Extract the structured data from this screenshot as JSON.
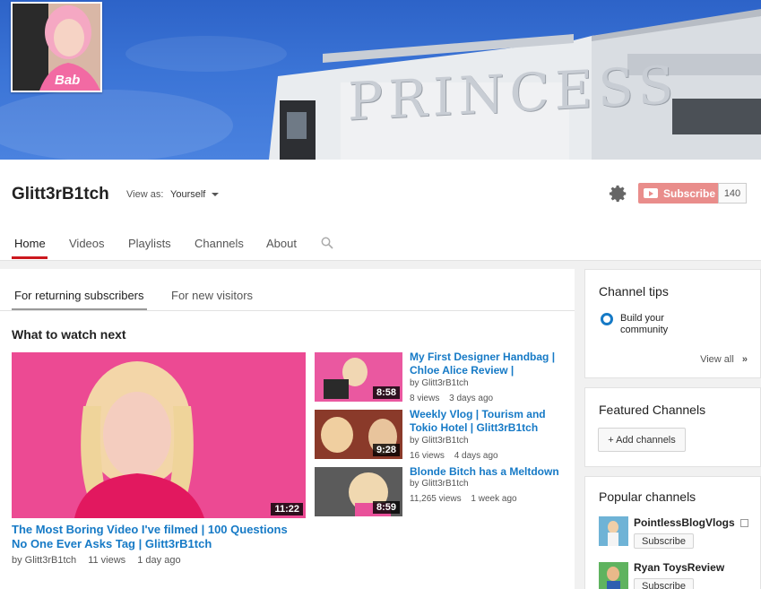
{
  "channel": {
    "name": "Glitt3rB1tch",
    "view_as_label": "View as:",
    "view_as_value": "Yourself",
    "subscribe_label": "Subscribe",
    "subscriber_count": "140",
    "banner_text": "PRINCESS",
    "avatar_shirt_text": "Bab"
  },
  "tabs": [
    "Home",
    "Videos",
    "Playlists",
    "Channels",
    "About"
  ],
  "subtabs": [
    "For returning subscribers",
    "For new visitors"
  ],
  "section_title": "What to watch next",
  "featured_video": {
    "title": "The Most Boring Video I've filmed | 100 Questions No One Ever Asks Tag | Glitt3rB1tch",
    "by": "by Glitt3rB1tch",
    "views": "11 views",
    "age": "1 day ago",
    "duration": "11:22"
  },
  "videos": [
    {
      "title": "My First Designer Handbag | Chloe Alice Review |",
      "by": "by Glitt3rB1tch",
      "views": "8 views",
      "age": "3 days ago",
      "duration": "8:58"
    },
    {
      "title": "Weekly Vlog | Tourism and Tokio Hotel | Glitt3rB1tch",
      "by": "by Glitt3rB1tch",
      "views": "16 views",
      "age": "4 days ago",
      "duration": "9:28"
    },
    {
      "title": "Blonde Bitch has a Meltdown",
      "by": "by Glitt3rB1tch",
      "views": "11,265 views",
      "age": "1 week ago",
      "duration": "8:59"
    }
  ],
  "sidebar": {
    "tips_title": "Channel tips",
    "tip_text": "Build your community",
    "view_all": "View all",
    "featured_title": "Featured Channels",
    "add_channels": "+ Add channels",
    "popular_title": "Popular channels",
    "popular": [
      {
        "name": "PointlessBlogVlogs",
        "subscribe": "Subscribe"
      },
      {
        "name": "Ryan ToysReview",
        "subscribe": "Subscribe"
      }
    ]
  },
  "colors": {
    "accent": "#cc181e",
    "link": "#167ac6",
    "subscribe_bg": "#e98d8b"
  }
}
